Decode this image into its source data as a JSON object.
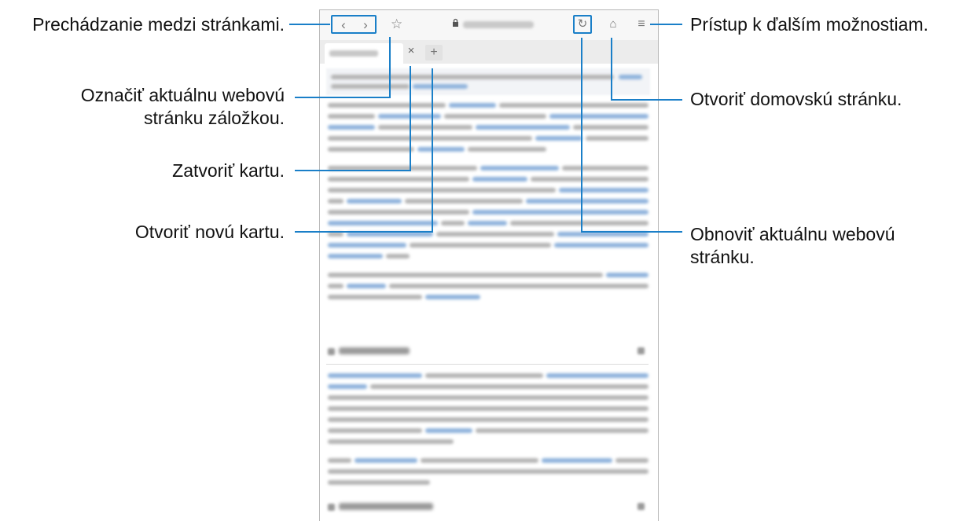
{
  "callouts": {
    "navigate": "Prechádzanie medzi stránkami.",
    "bookmark": [
      "Označiť aktuálnu webovú",
      "stránku záložkou."
    ],
    "close_tab": "Zatvoriť kartu.",
    "new_tab": "Otvoriť novú kartu.",
    "more_options": "Prístup k ďalším možnostiam.",
    "home": "Otvoriť domovskú stránku.",
    "refresh": [
      "Obnoviť aktuálnu webovú",
      "stránku."
    ]
  },
  "browser": {
    "back_icon": "‹",
    "forward_icon": "›",
    "bookmark_icon": "☆",
    "lock_icon": "lock-icon",
    "reload_icon": "↻",
    "home_icon": "⌂",
    "menu_icon": "≡",
    "close_tab_icon": "×",
    "new_tab_icon": "+"
  },
  "colors": {
    "accent": "#1a7fc8"
  }
}
